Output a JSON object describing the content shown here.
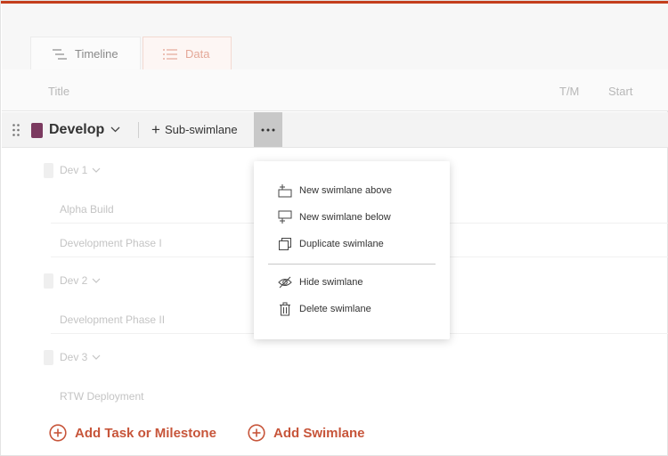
{
  "tabs": [
    {
      "label": "Timeline",
      "icon": "timeline-icon"
    },
    {
      "label": "Data",
      "icon": "list-icon"
    }
  ],
  "columns": {
    "title": "Title",
    "tm": "T/M",
    "start": "Start"
  },
  "swimlane": {
    "color": "#7b3a60",
    "title": "Develop",
    "sub_swimlane_label": "Sub-swimlane"
  },
  "groups": [
    {
      "label": "Dev 1",
      "tasks": [
        "Alpha Build",
        "Development Phase I"
      ]
    },
    {
      "label": "Dev 2",
      "tasks": [
        "Development Phase II"
      ]
    },
    {
      "label": "Dev 3",
      "tasks": [
        "RTW Deployment"
      ]
    }
  ],
  "context_menu": {
    "items": [
      {
        "label": "New swimlane above",
        "icon": "insert-above-icon"
      },
      {
        "label": "New swimlane below",
        "icon": "insert-below-icon"
      },
      {
        "label": "Duplicate swimlane",
        "icon": "duplicate-icon"
      },
      {
        "label": "Hide swimlane",
        "icon": "eye-hidden-icon"
      },
      {
        "label": "Delete swimlane",
        "icon": "trash-icon"
      }
    ]
  },
  "footer": {
    "add_task_label": "Add Task or Milestone",
    "add_swimlane_label": "Add Swimlane"
  },
  "colors": {
    "accent": "#c43e1c",
    "link": "#c7553a"
  }
}
